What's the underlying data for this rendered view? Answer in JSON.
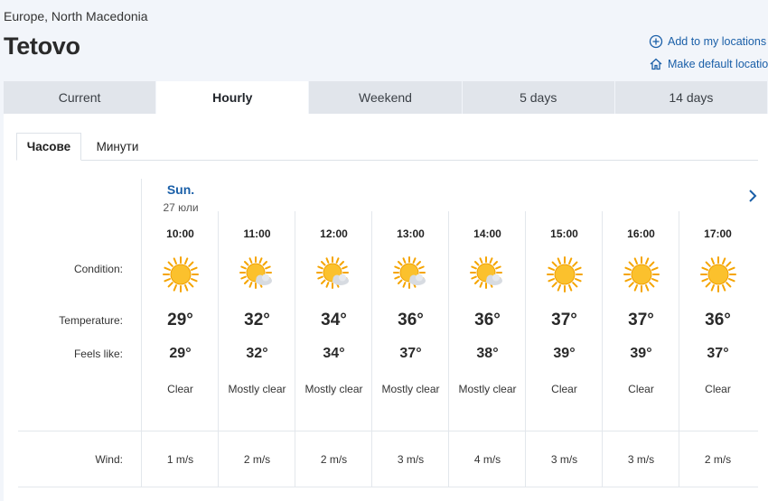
{
  "header": {
    "region": "Europe, North Macedonia",
    "city": "Tetovo",
    "add_location": "Add to my locations",
    "make_default": "Make default location"
  },
  "tabs": [
    {
      "label": "Current",
      "active": false
    },
    {
      "label": "Hourly",
      "active": true
    },
    {
      "label": "Weekend",
      "active": false
    },
    {
      "label": "5 days",
      "active": false
    },
    {
      "label": "14 days",
      "active": false
    }
  ],
  "subtabs": [
    {
      "label": "Часове",
      "active": true
    },
    {
      "label": "Минути",
      "active": false
    }
  ],
  "row_labels": {
    "condition": "Condition:",
    "temperature": "Temperature:",
    "feels_like": "Feels like:",
    "wind": "Wind:"
  },
  "day": {
    "name": "Sun.",
    "date": "27 юли"
  },
  "hours": [
    {
      "time": "10:00",
      "icon": "sun-icon",
      "temp": "29°",
      "feels": "29°",
      "condition": "Clear",
      "wind": "1 m/s"
    },
    {
      "time": "11:00",
      "icon": "sun-cloud-icon",
      "temp": "32°",
      "feels": "32°",
      "condition": "Mostly clear",
      "wind": "2 m/s"
    },
    {
      "time": "12:00",
      "icon": "sun-cloud-icon",
      "temp": "34°",
      "feels": "34°",
      "condition": "Mostly clear",
      "wind": "2 m/s"
    },
    {
      "time": "13:00",
      "icon": "sun-cloud-icon",
      "temp": "36°",
      "feels": "37°",
      "condition": "Mostly clear",
      "wind": "3 m/s"
    },
    {
      "time": "14:00",
      "icon": "sun-cloud-icon",
      "temp": "36°",
      "feels": "38°",
      "condition": "Mostly clear",
      "wind": "4 m/s"
    },
    {
      "time": "15:00",
      "icon": "sun-icon",
      "temp": "37°",
      "feels": "39°",
      "condition": "Clear",
      "wind": "3 m/s"
    },
    {
      "time": "16:00",
      "icon": "sun-icon",
      "temp": "37°",
      "feels": "39°",
      "condition": "Clear",
      "wind": "3 m/s"
    },
    {
      "time": "17:00",
      "icon": "sun-icon",
      "temp": "36°",
      "feels": "37°",
      "condition": "Clear",
      "wind": "2 m/s"
    }
  ],
  "colors": {
    "accent": "#1a5fa8",
    "sun": "#f6b40e",
    "cloud": "#c9ced6"
  }
}
